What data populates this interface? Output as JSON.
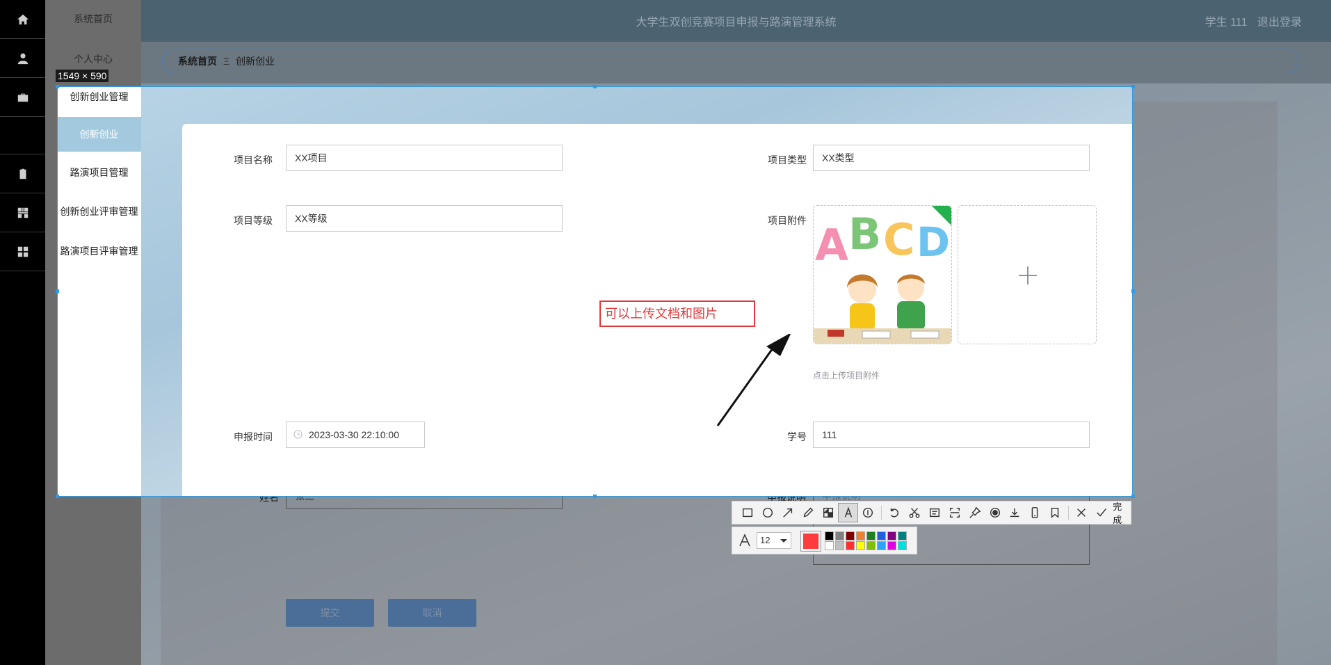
{
  "header": {
    "title": "大学生双创竞赛项目申报与路演管理系统",
    "user": "学生 111",
    "logout": "退出登录"
  },
  "sidebar": {
    "items": [
      {
        "label": "系统首页",
        "icon": "home-icon"
      },
      {
        "label": "个人中心",
        "icon": "user-icon"
      },
      {
        "label": "创新创业管理",
        "icon": "briefcase-icon"
      },
      {
        "label": "创新创业",
        "icon": ""
      },
      {
        "label": "路演项目管理",
        "icon": "clipboard-icon"
      },
      {
        "label": "创新创业评审管理",
        "icon": "grid-icon"
      },
      {
        "label": "路演项目评审管理",
        "icon": "apps-icon"
      }
    ]
  },
  "breadcrumb": {
    "home": "系统首页",
    "separator": "Ξ",
    "current": "创新创业"
  },
  "screenshot_size_label": "1549 × 590",
  "form": {
    "project_name": {
      "label": "项目名称",
      "value": "XX项目"
    },
    "project_type": {
      "label": "项目类型",
      "value": "XX类型"
    },
    "project_level": {
      "label": "项目等级",
      "value": "XX等级"
    },
    "attachment": {
      "label": "项目附件",
      "hint": "点击上传项目附件"
    },
    "apply_time": {
      "label": "申报时间",
      "value": "2023-03-30 22:10:00"
    },
    "student_id": {
      "label": "学号",
      "value": "111"
    },
    "name": {
      "label": "姓名",
      "value": "张三"
    },
    "description": {
      "label": "申报说明",
      "placeholder": "申报说明"
    },
    "submit": "提交",
    "cancel": "取消"
  },
  "annotation": {
    "text": "可以上传文档和图片",
    "color": "#e13a3a"
  },
  "toolbar": {
    "done_label": "完成",
    "font_size": "12",
    "current_color": "#fd3d3d",
    "palette": [
      "#000000",
      "#808080",
      "#800000",
      "#f08030",
      "#208020",
      "#2060e0",
      "#800080",
      "#008080",
      "#ffffff",
      "#c0c0c0",
      "#ff3030",
      "#ffff00",
      "#80c000",
      "#30a0ff",
      "#e000e0",
      "#00e0e0"
    ]
  }
}
